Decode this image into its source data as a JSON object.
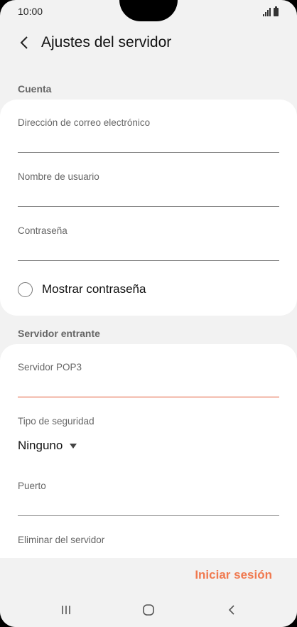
{
  "status_bar": {
    "time": "10:00"
  },
  "app_bar": {
    "title": "Ajustes del servidor"
  },
  "sections": {
    "account": {
      "header": "Cuenta",
      "email_label": "Dirección de correo electrónico",
      "email_value": "",
      "username_label": "Nombre de usuario",
      "username_value": "",
      "password_label": "Contraseña",
      "password_value": "",
      "show_password_label": "Mostrar contraseña",
      "show_password_checked": false
    },
    "incoming": {
      "header": "Servidor entrante",
      "pop3_label": "Servidor POP3",
      "pop3_value": "",
      "security_label": "Tipo de seguridad",
      "security_value": "Ninguno",
      "port_label": "Puerto",
      "port_value": "",
      "delete_label": "Eliminar del servidor"
    }
  },
  "bottom": {
    "signin_label": "Iniciar sesión"
  },
  "colors": {
    "accent": "#f0794f",
    "active_underline": "#e0532e"
  }
}
